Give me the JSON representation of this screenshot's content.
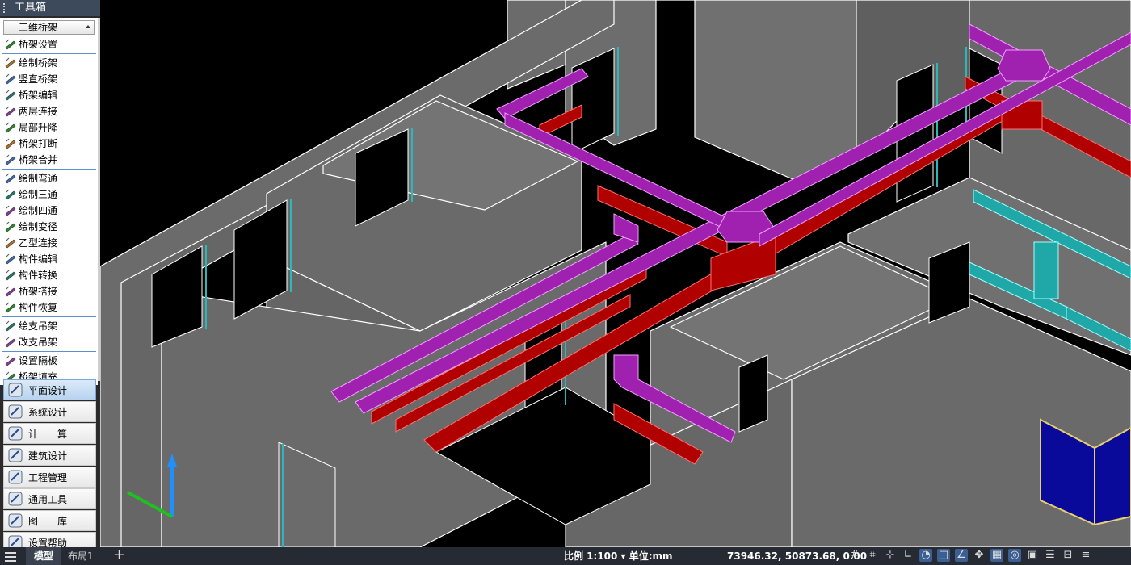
{
  "toolbox": {
    "title": "工具箱",
    "category": "三维桥架",
    "groups": [
      [
        {
          "label": "桥架设置",
          "icon": "tray-settings-icon"
        }
      ],
      [
        {
          "label": "绘制桥架",
          "icon": "draw-tray-icon"
        },
        {
          "label": "竖直桥架",
          "icon": "vertical-tray-icon"
        },
        {
          "label": "桥架编辑",
          "icon": "edit-tray-icon"
        },
        {
          "label": "两层连接",
          "icon": "two-layer-connect-icon"
        },
        {
          "label": "局部升降",
          "icon": "local-lift-icon"
        },
        {
          "label": "桥架打断",
          "icon": "break-tray-icon"
        },
        {
          "label": "桥架合并",
          "icon": "merge-tray-icon"
        }
      ],
      [
        {
          "label": "绘制弯通",
          "icon": "draw-elbow-icon"
        },
        {
          "label": "绘制三通",
          "icon": "draw-tee-icon"
        },
        {
          "label": "绘制四通",
          "icon": "draw-cross-icon"
        },
        {
          "label": "绘制变径",
          "icon": "draw-reducer-icon"
        },
        {
          "label": "乙型连接",
          "icon": "z-connect-icon"
        },
        {
          "label": "构件编辑",
          "icon": "edit-component-icon"
        },
        {
          "label": "构件转换",
          "icon": "convert-component-icon"
        },
        {
          "label": "桥架搭接",
          "icon": "tray-overlap-icon"
        },
        {
          "label": "构件恢复",
          "icon": "restore-component-icon"
        }
      ],
      [
        {
          "label": "绘支吊架",
          "icon": "draw-hanger-icon"
        },
        {
          "label": "改支吊架",
          "icon": "modify-hanger-icon"
        }
      ],
      [
        {
          "label": "设置隔板",
          "icon": "set-partition-icon"
        },
        {
          "label": "桥架填充",
          "icon": "fill-tray-icon"
        }
      ]
    ],
    "modules": [
      {
        "label": "平面设计",
        "icon": "plan-design-icon",
        "active": true
      },
      {
        "label": "系统设计",
        "icon": "system-design-icon",
        "active": false
      },
      {
        "label": "计　　算",
        "icon": "calculation-icon",
        "active": false
      },
      {
        "label": "建筑设计",
        "icon": "architecture-design-icon",
        "active": false
      },
      {
        "label": "工程管理",
        "icon": "project-management-icon",
        "active": false
      },
      {
        "label": "通用工具",
        "icon": "general-tools-icon",
        "active": false
      },
      {
        "label": "图　　库",
        "icon": "library-icon",
        "active": false
      },
      {
        "label": "设置帮助",
        "icon": "settings-help-icon",
        "active": false
      }
    ]
  },
  "statusbar": {
    "tabs": [
      "模型",
      "布局1"
    ],
    "add_tab": "+",
    "scale": "比例 1:100 ▾ 单位:mm",
    "coords": "73946.32, 50873.68, 0.00"
  },
  "colors": {
    "wall_face": "#6b6b6b",
    "wall_edge": "#ffffff",
    "tray_purple": "#a020b0",
    "tray_red": "#b00000",
    "tray_cyan": "#2ab8b8",
    "window_blue": "#0a0a9a"
  }
}
